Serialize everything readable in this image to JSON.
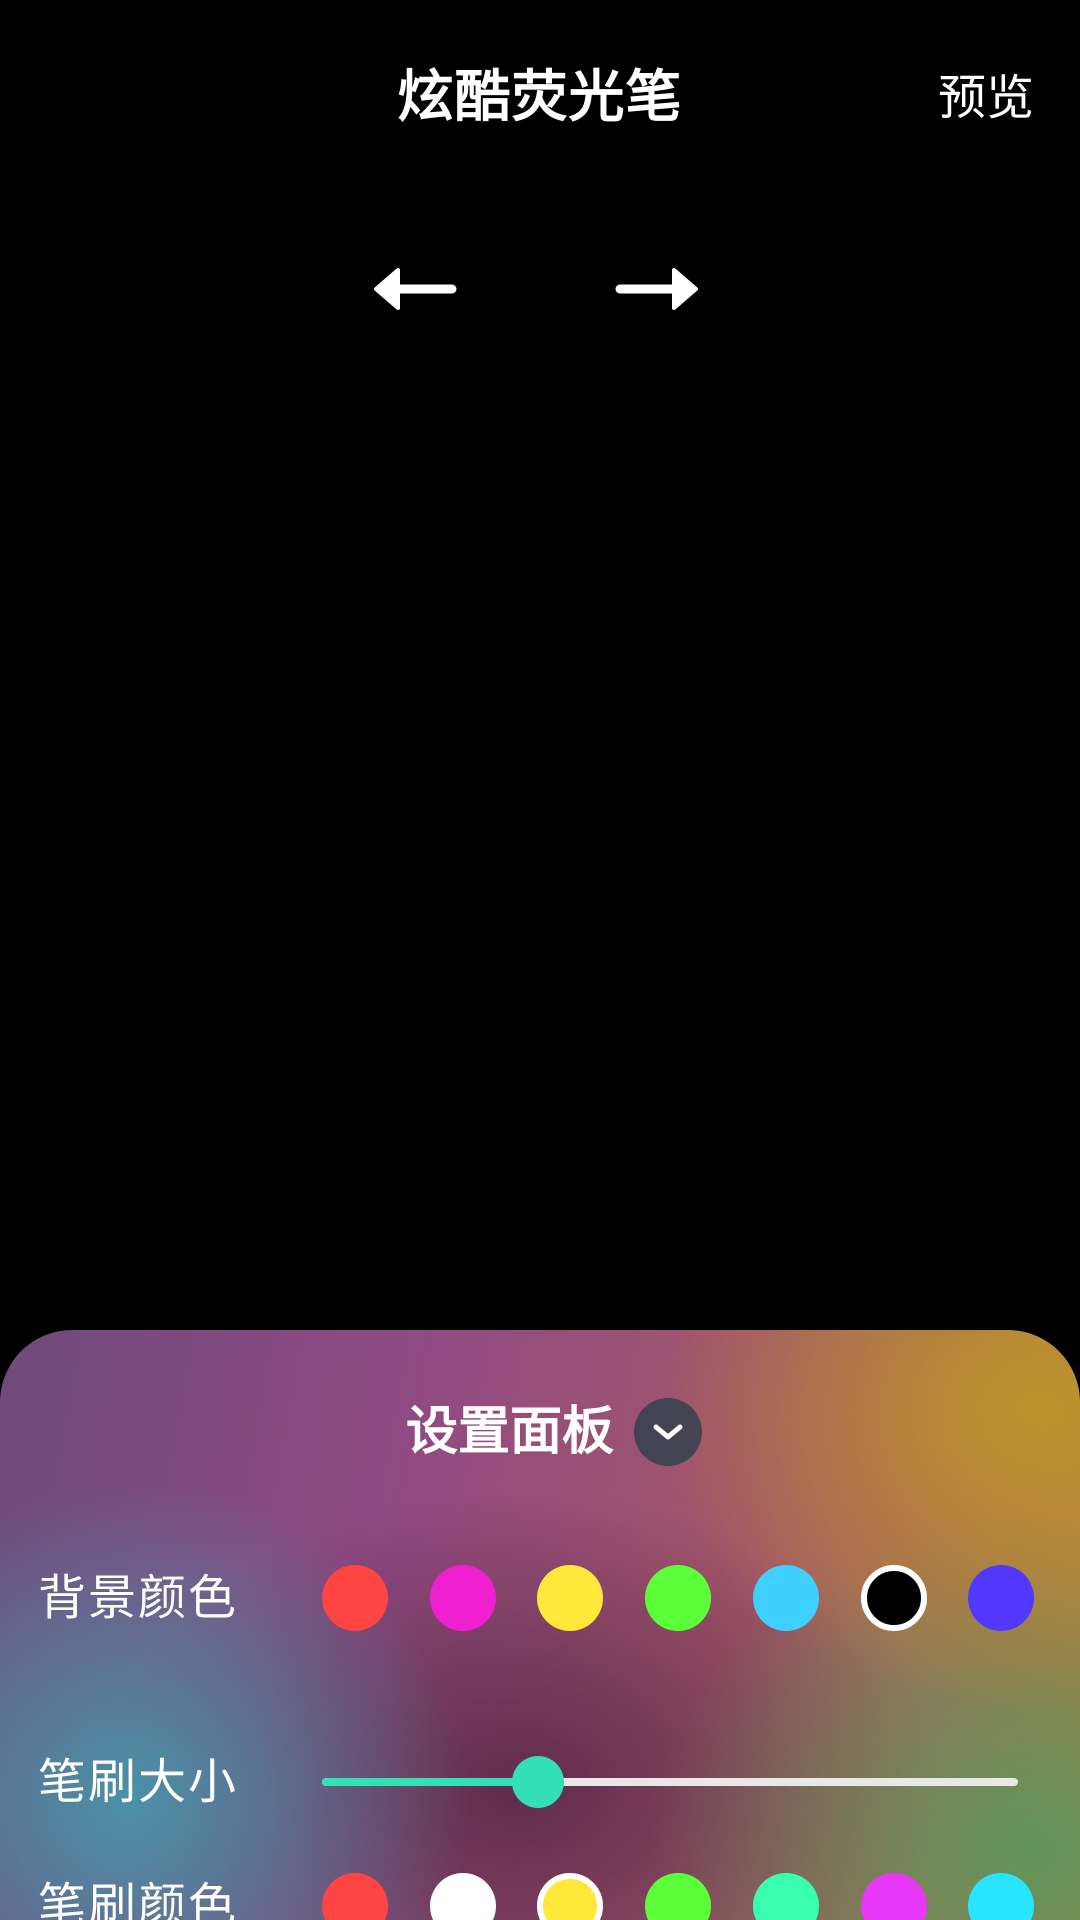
{
  "header": {
    "title": "炫酷荧光笔",
    "preview_label": "预览"
  },
  "toolbar": {
    "undo_icon": "arrow-left-icon",
    "redo_icon": "arrow-right-icon"
  },
  "panel": {
    "title": "设置面板",
    "collapse_icon": "chevron-down-icon",
    "background_color": {
      "label": "背景颜色",
      "swatches": [
        "#ff4444",
        "#f020d0",
        "#ffe83a",
        "#5aff3a",
        "#40d0ff",
        "#000000",
        "#5238ff"
      ],
      "selected_index": 5
    },
    "brush_size": {
      "label": "笔刷大小",
      "value_fraction": 0.31,
      "fill_color": "#33dfb4",
      "track_color": "#e8e8e8"
    },
    "brush_color": {
      "label": "笔刷颜色",
      "swatches": [
        "#ff4444",
        "#ffffff",
        "#ffe83a",
        "#5aff3a",
        "#3affb0",
        "#e838f8",
        "#28e4ff"
      ],
      "selected_index": 2
    }
  }
}
